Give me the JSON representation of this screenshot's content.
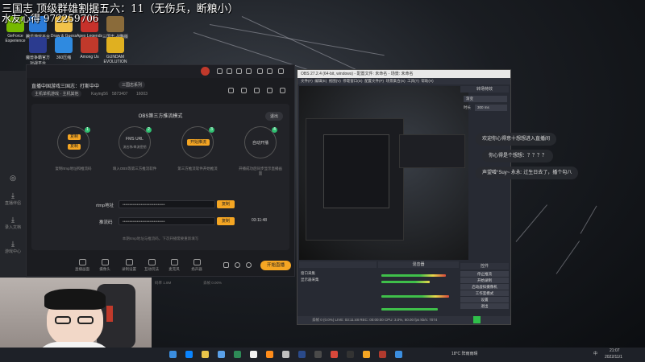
{
  "overlay": {
    "title": "三国志 顶级群雄割据五六：11（无伤兵，断粮小）",
    "id": "水友心得 972259706",
    "recording_label": "REC"
  },
  "desktop_icons": [
    {
      "label": "GeForce Experience",
      "color": "#76b900"
    },
    {
      "label": "腾讯游戏平台",
      "color": "#2b7bd8"
    },
    {
      "label": "Draw & Guess",
      "color": "#f2c34a"
    },
    {
      "label": "Apex Legends",
      "color": "#c7312b"
    },
    {
      "label": "三国志·战略版",
      "color": "#8a6b3a"
    },
    {
      "label": "魔兽争霸官方对战平台",
      "color": "#2b3b8f"
    },
    {
      "label": "360压缩",
      "color": "#2f8ae0"
    },
    {
      "label": "Among Us",
      "color": "#c0392b"
    },
    {
      "label": "GUNDAM EVOLUTION",
      "color": "#e0b020"
    }
  ],
  "left_strip": [
    {
      "glyph": "◎",
      "label": ""
    },
    {
      "glyph": "⤓",
      "label": "直播伴侣"
    },
    {
      "glyph": "⤓",
      "label": "录入文档"
    },
    {
      "glyph": "⤓",
      "label": "游戏中心"
    }
  ],
  "app": {
    "room_title": "直播中国游戏三国志：打斯中中",
    "category": "三国志系列",
    "sub_tag": "主机单机游戏 · 主机其他",
    "followers": "Kaying56",
    "fans": "5873407",
    "likes": "16003",
    "mode_title": "OBS第三方推流模式",
    "exit_label": "退出",
    "steps": [
      {
        "num": "1",
        "buttons": [
          "复制",
          "复制"
        ],
        "text": "复制rtmp地址和推流码"
      },
      {
        "num": "2",
        "title": "FMS URL",
        "subtitle": "流名称/串流密钥",
        "text": "填入OBS等第三方推流软件"
      },
      {
        "num": "3",
        "button": "开始推流",
        "text": "第三方推流软件开始推流"
      },
      {
        "num": "4",
        "title": "自动开播",
        "text": "开播成功后同步显示直播画面"
      }
    ],
    "rtmp_label": "rtmp地址",
    "rtmp_value": "••••••••••••••••••••••••••••••",
    "key_label": "推流码",
    "key_value": "••••••••••••••••••••••••••••••",
    "copy_label": "复制",
    "hint": "本期rtmp地址与推流码，下次开播需要重新填写",
    "tools": [
      "直播画面",
      "摄像头",
      "录制设置",
      "互动玩法",
      "麦克风",
      "扬声器"
    ],
    "start_live": "开始直播",
    "timer": "03:11:48",
    "status_items": [
      "CPU 20%",
      "FPS 60",
      "码率 1.8M",
      "丢帧 0.00%"
    ]
  },
  "obs": {
    "title": "OBS 27.2.4 (64-bit, windows) - 配置文件: 未命名 - 场景: 未命名",
    "menu": [
      "文件(F)",
      "编辑(E)",
      "视图(V)",
      "停靠窗口(D)",
      "配置文件(P)",
      "场景集合(S)",
      "工具(T)",
      "帮助(H)"
    ],
    "mixer_header": "混音器",
    "transitions_header": "转场特效",
    "controls_header": "控件",
    "transition_value": "渐变",
    "duration_label": "时长",
    "duration_value": "300 ms",
    "controls": [
      "停止推流",
      "开始录制",
      "启动虚拟摄像机",
      "工作室模式",
      "设置",
      "退出"
    ],
    "sources": [
      "窗口采集",
      "显示器采集"
    ],
    "status": "丢帧 0 (0.0%)    LIVE: 03:11:48    REC: 00:00:00    CPU: 3.0%, 60.00 fps    kb/s: 7074"
  },
  "chat": [
    "欢迎你心得意十想想进入直播间",
    "你心得是个想想：？？？？",
    "声望噌°Suy~ 永永: 过生日去了，播个勾八"
  ],
  "taskbar": {
    "weather": "18°C 阵雨雨晴",
    "time": "21:07",
    "date": "2022/11/1",
    "lang": "中"
  }
}
